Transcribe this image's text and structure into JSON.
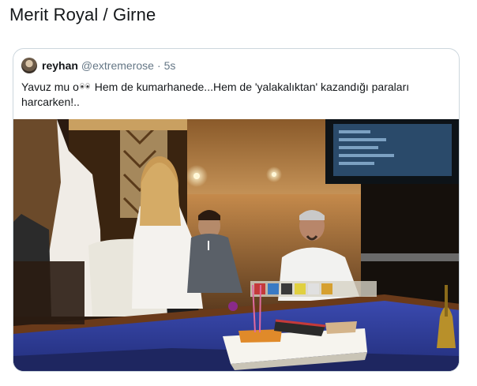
{
  "heading": {
    "title": "Merit Royal / Girne"
  },
  "quoted_tweet": {
    "display_name": "reyhan",
    "handle": "@extremerose",
    "separator": "·",
    "time": "5s",
    "text_part1": "Yavuz mu o",
    "text_emoji": "eyes-emoji",
    "text_part2": " Hem de kumarhanede...Hem de 'yalakalıktan' kazandığı paraları harcarken!..",
    "media": {
      "type": "photo"
    }
  },
  "colors": {
    "text": "#14171a",
    "secondary_text": "#657786",
    "card_border": "#ccd6dd",
    "table_felt": "#2f3e9e"
  }
}
